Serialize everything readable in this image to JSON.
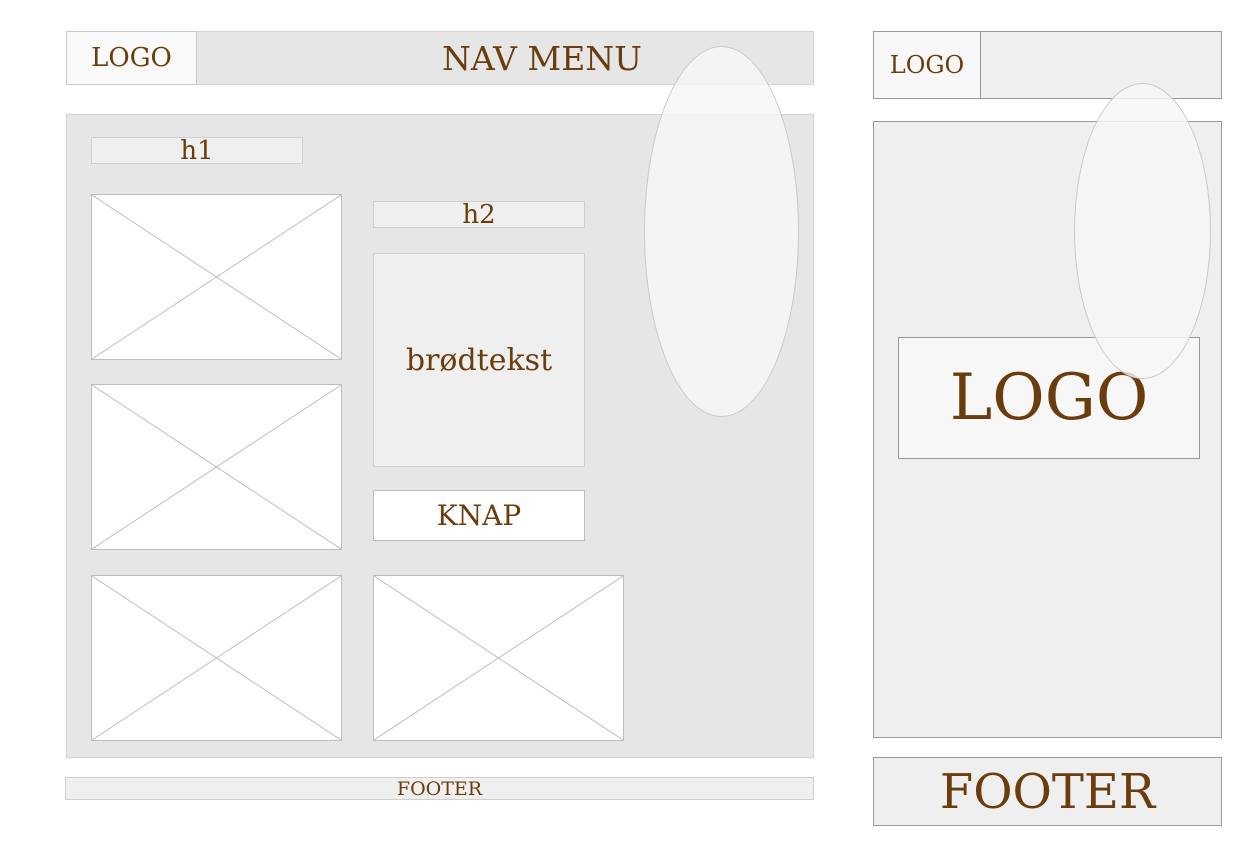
{
  "desktop": {
    "header": {
      "logo": "LOGO",
      "nav": "NAV MENU"
    },
    "content": {
      "h1": "h1",
      "h2": "h2",
      "body_text": "brødtekst",
      "button": "KNAP"
    },
    "footer": "FOOTER"
  },
  "mobile": {
    "header": {
      "logo": "LOGO"
    },
    "content": {
      "logo": "LOGO"
    },
    "footer": "FOOTER"
  }
}
